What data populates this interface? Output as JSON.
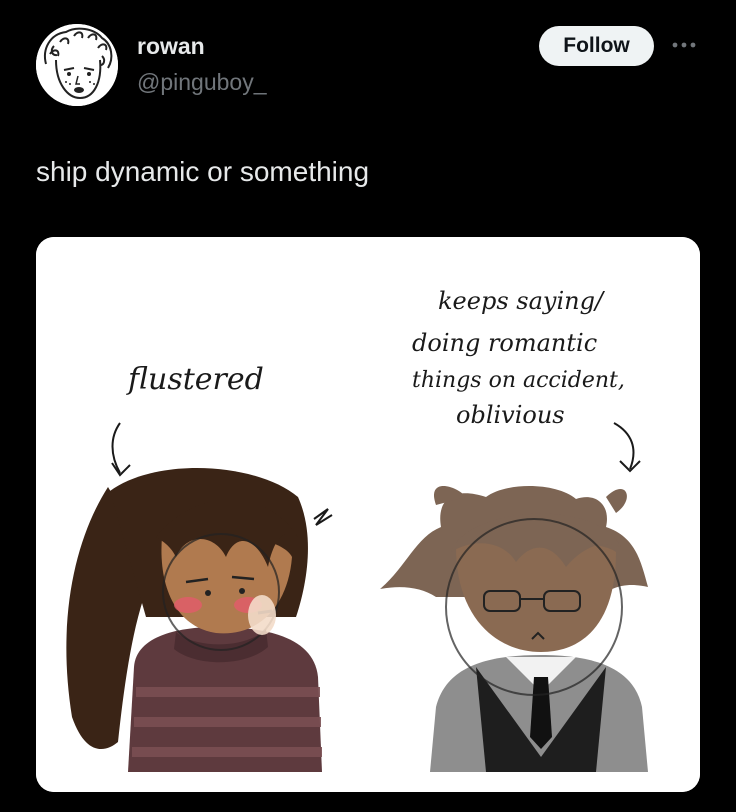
{
  "author": {
    "display_name": "rowan",
    "handle": "@pinguboy_"
  },
  "actions": {
    "follow_label": "Follow",
    "more_icon": "more-dots-icon"
  },
  "post": {
    "text": "ship dynamic or something"
  },
  "media": {
    "annotation_left": "flustered",
    "annotation_right_lines": [
      "keeps saying/",
      "doing romantic",
      "things on accident,",
      "oblivious"
    ]
  },
  "colors": {
    "background": "#000000",
    "primary_text": "#e7e9ea",
    "secondary_text": "#71767b",
    "follow_bg": "#eff3f4"
  }
}
